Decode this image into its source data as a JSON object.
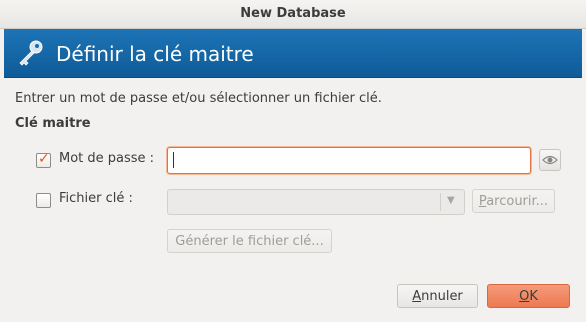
{
  "window": {
    "title": "New Database"
  },
  "banner": {
    "title": "Définir la clé maitre",
    "icon": "key-icon"
  },
  "intro": "Entrer un mot de passe et/ou sélectionner un fichier clé.",
  "section_title": "Clé maitre",
  "password": {
    "checked": true,
    "label": "Mot de passe :",
    "value": "",
    "toggle_icon": "eye-icon"
  },
  "keyfile": {
    "checked": false,
    "label": "Fichier  clé :",
    "value": "",
    "browse_first": "P",
    "browse_rest": "arcourir...",
    "generate_label": "Générer le fichier clé..."
  },
  "buttons": {
    "cancel_first": "A",
    "cancel_rest": "nnuler",
    "ok_first": "O",
    "ok_rest": "K"
  },
  "colors": {
    "banner": "#1466a8",
    "accent": "#e2571c",
    "ok_button": "#ef845e"
  }
}
